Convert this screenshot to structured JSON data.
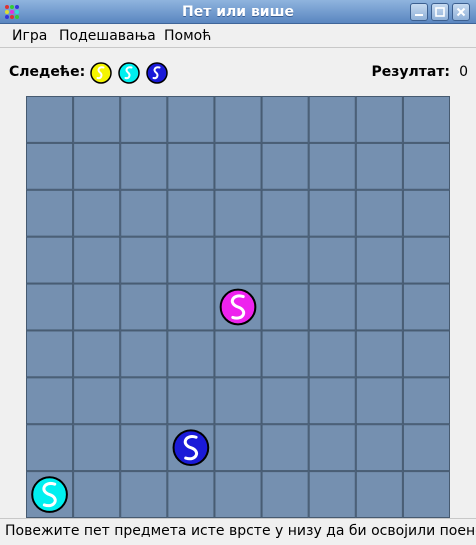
{
  "window": {
    "title": "Пет или више"
  },
  "menu": {
    "items": [
      {
        "label": "Игра"
      },
      {
        "label": "Подешавања"
      },
      {
        "label": "Помоћ"
      }
    ]
  },
  "info": {
    "next_label": "Следеће:",
    "next_balls": [
      {
        "color": "yellow",
        "hex": "#f5f500"
      },
      {
        "color": "cyan",
        "hex": "#00f0f0"
      },
      {
        "color": "blue",
        "hex": "#1a1ad8"
      }
    ],
    "score_label": "Резултат:",
    "score_value": "0"
  },
  "board": {
    "rows": 9,
    "cols": 9,
    "cell_color": "#7590b0",
    "grid_color": "#465a70",
    "balls": [
      {
        "row": 4,
        "col": 4,
        "color": "magenta",
        "hex": "#ee22ee"
      },
      {
        "row": 7,
        "col": 3,
        "color": "blue",
        "hex": "#1a1ad8"
      },
      {
        "row": 8,
        "col": 0,
        "color": "cyan",
        "hex": "#00f0f0"
      }
    ]
  },
  "status": {
    "text": "Повежите пет предмета исте врсте у низу да би освојили поене!"
  }
}
